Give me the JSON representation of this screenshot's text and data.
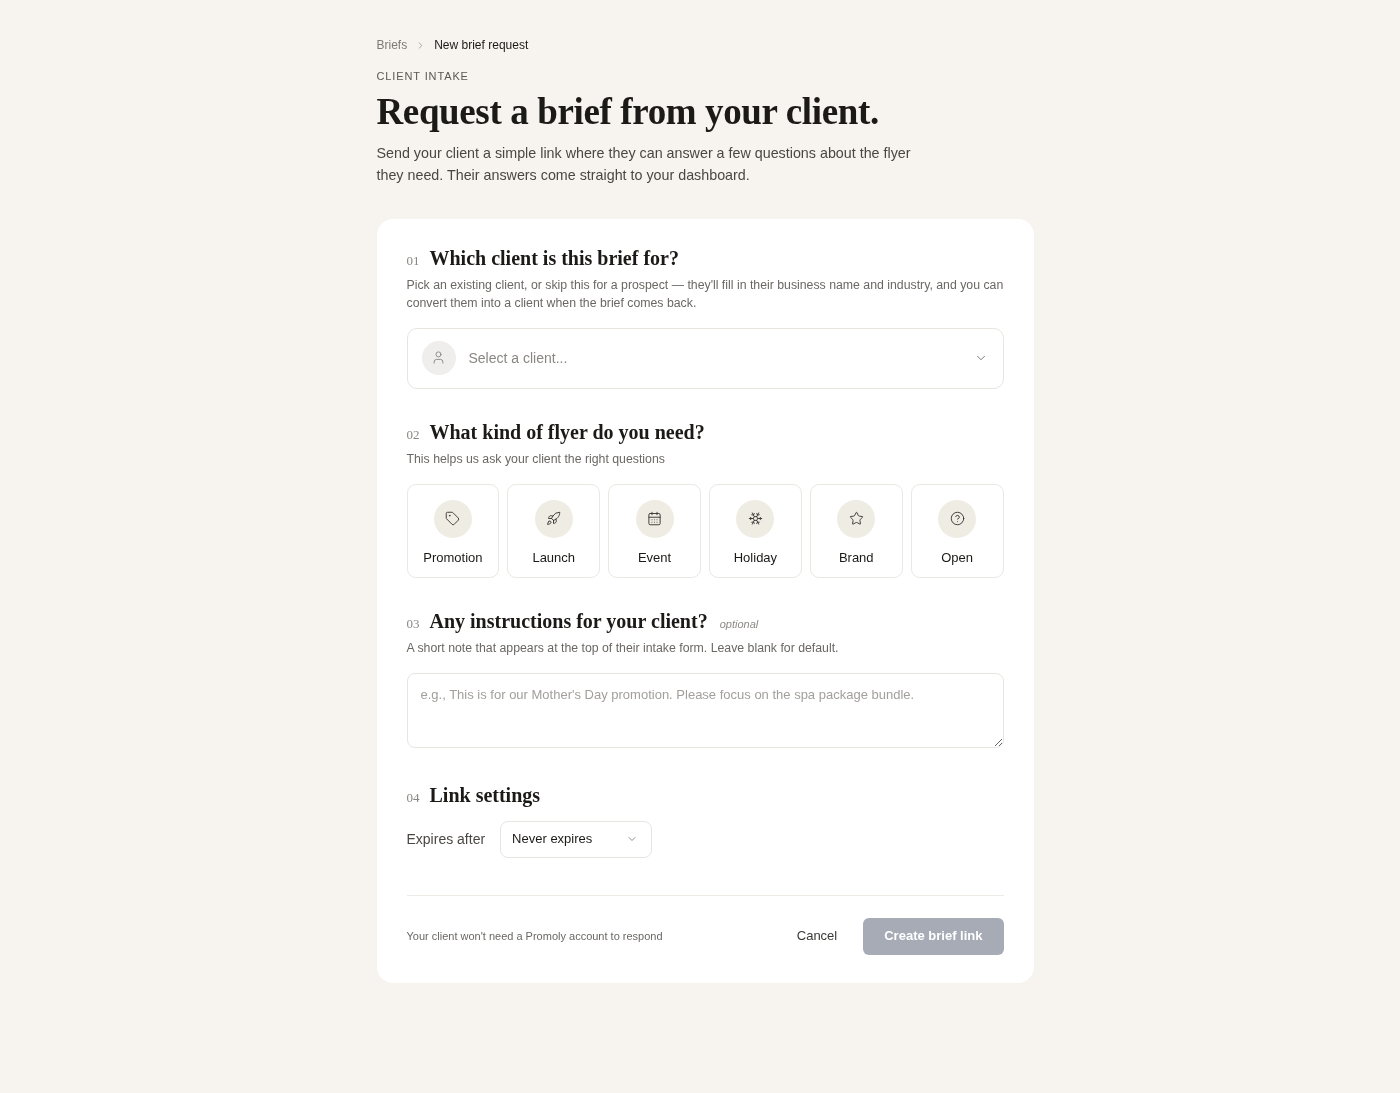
{
  "breadcrumb": [
    {
      "label": "Briefs",
      "current": false
    },
    {
      "label": "New brief request",
      "current": true
    }
  ],
  "eyebrow": "CLIENT INTAKE",
  "title": "Request a brief from your client.",
  "intro": "Send your client a simple link where they can answer a few questions about the flyer they need. Their answers come straight to your dashboard.",
  "sections": [
    {
      "kind": "client_select",
      "number": "01",
      "title": "Which client is this brief for?",
      "description": "Pick an existing client, or skip this for a prospect — they'll fill in their business name and industry, and you can convert them into a client when the brief comes back.",
      "select": {
        "placeholder": "Select a client..."
      }
    },
    {
      "kind": "flyer_type",
      "number": "02",
      "title": "What kind of flyer do you need?",
      "description": "This helps us ask your client the right questions",
      "options": [
        {
          "label": "Promotion",
          "selected": false
        },
        {
          "label": "Launch",
          "selected": false
        },
        {
          "label": "Event",
          "selected": false
        },
        {
          "label": "Holiday",
          "selected": false
        },
        {
          "label": "Brand",
          "selected": false
        },
        {
          "label": "Open",
          "selected": false
        }
      ]
    },
    {
      "kind": "instructions",
      "number": "03",
      "title": "Any instructions for your client?",
      "tag": "optional",
      "description": "A short note that appears at the top of their intake form. Leave blank for default.",
      "textarea": {
        "placeholder": "e.g., This is for our Mother's Day promotion. Please focus on the spa package bundle."
      }
    },
    {
      "kind": "link_settings",
      "number": "04",
      "title": "Link settings",
      "fields": [
        {
          "label": "Expires after",
          "value": "Never expires"
        }
      ]
    }
  ],
  "footer": {
    "note": "Your client won't need a Promoly account to respond",
    "cancel": {
      "label": "Cancel"
    },
    "submit": {
      "label": "Create brief link",
      "disabled": true
    }
  }
}
